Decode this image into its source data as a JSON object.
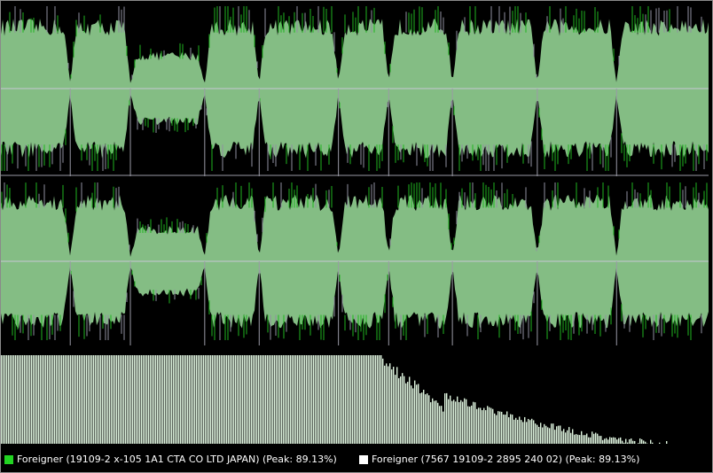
{
  "colors": {
    "background": "#000000",
    "wave_fill": "#84bd84",
    "wave_peak_green": "#1fb51f",
    "wave_peak_gray": "#8f8f9f",
    "center_line": "#c8c8d6",
    "spectrum_fill": "#dff5df",
    "legend_a": "#22d422",
    "legend_b": "#ffffff"
  },
  "tracks": [
    {
      "name": "swatch-green",
      "label": "Foreigner (19109-2 x-105 1A1 CTA CO LTD JAPAN) (Peak: 89.13%)"
    },
    {
      "name": "swatch-white",
      "label": "Foreigner (7567 19109-2 2895 240 02) (Peak: 89.13%)"
    }
  ],
  "track_markers_fraction": [
    0.098,
    0.183,
    0.288,
    0.365,
    0.477,
    0.548,
    0.638,
    0.758,
    0.87
  ]
}
